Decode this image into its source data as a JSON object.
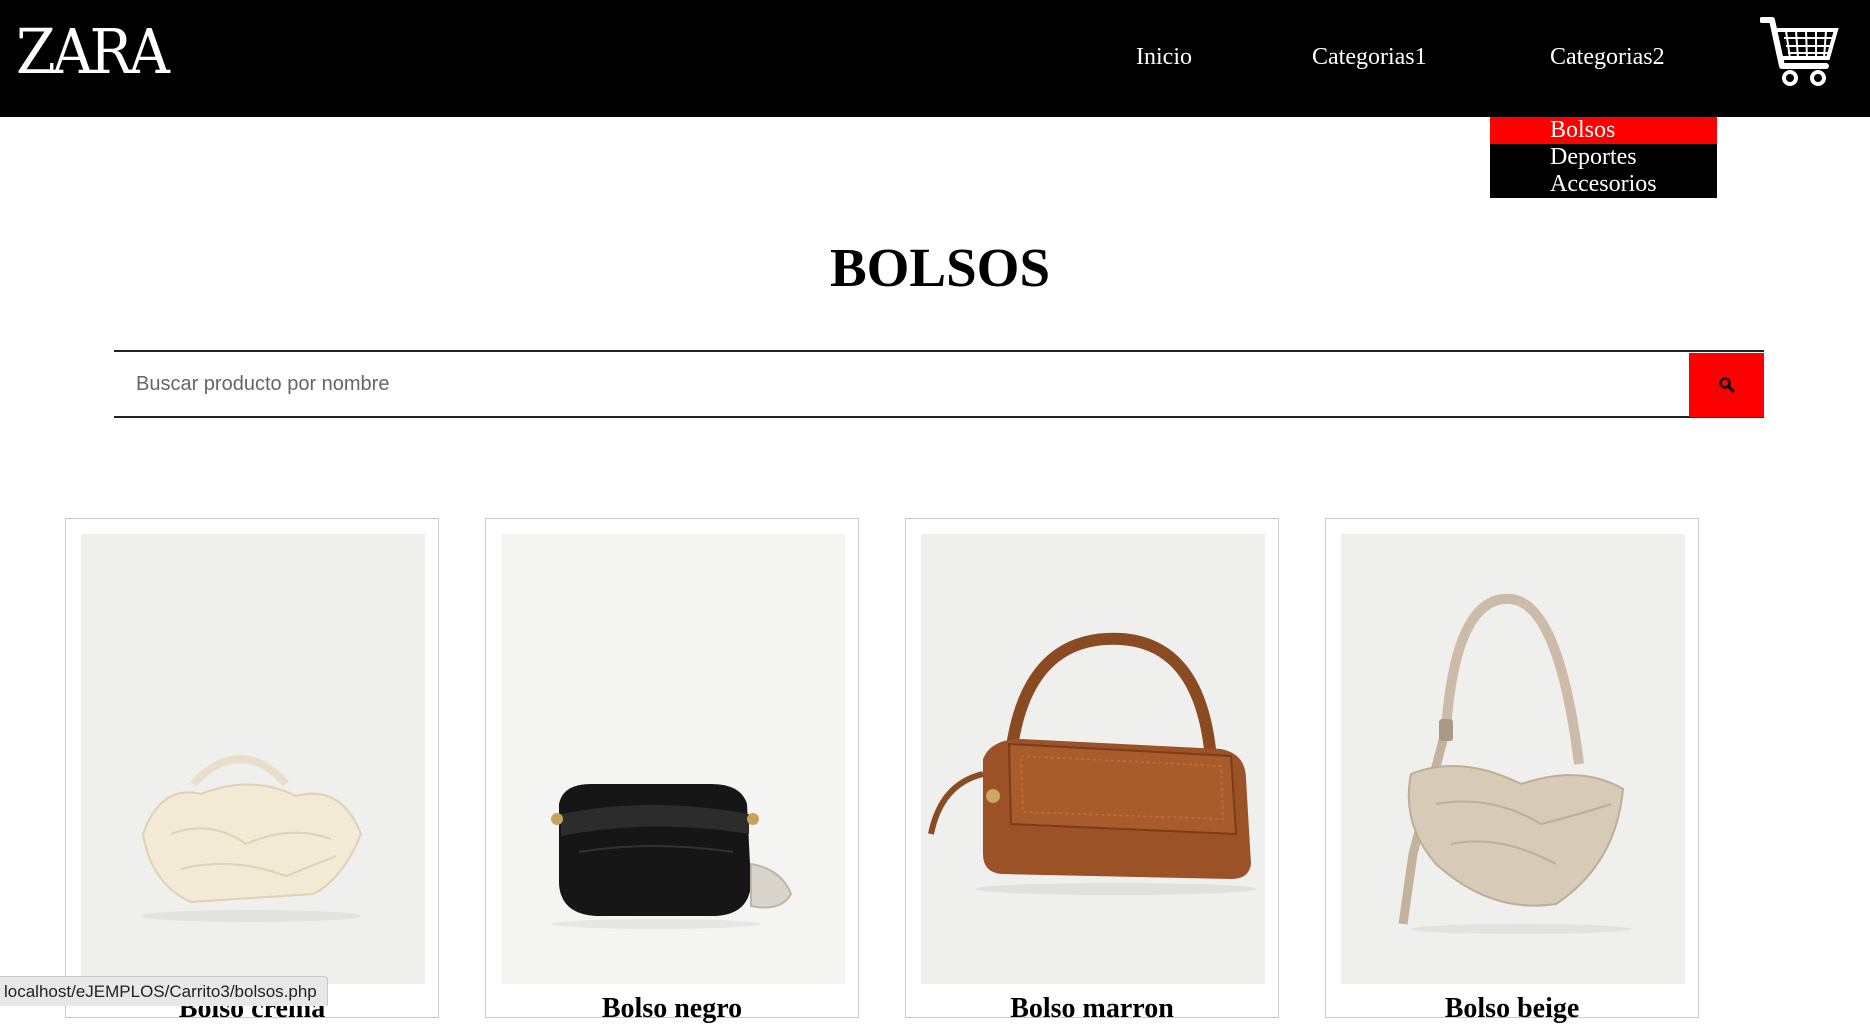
{
  "header": {
    "logo": "ZARA",
    "nav": [
      "Inicio",
      "Categorias1",
      "Categorias2"
    ],
    "cart_icon": "cart-icon"
  },
  "dropdown": {
    "items": [
      "Bolsos",
      "Deportes",
      "Accesorios"
    ],
    "active": "Bolsos"
  },
  "page": {
    "title": "BOLSOS"
  },
  "search": {
    "placeholder": "Buscar producto por nombre",
    "icon": "search-icon"
  },
  "products": [
    {
      "name": "Bolso crema"
    },
    {
      "name": "Bolso negro"
    },
    {
      "name": "Bolso marron"
    },
    {
      "name": "Bolso beige"
    }
  ],
  "statusbar": {
    "url": "localhost/eJEMPLOS/Carrito3/bolsos.php"
  },
  "colors": {
    "header": "#000000",
    "accent": "#ff0000"
  }
}
